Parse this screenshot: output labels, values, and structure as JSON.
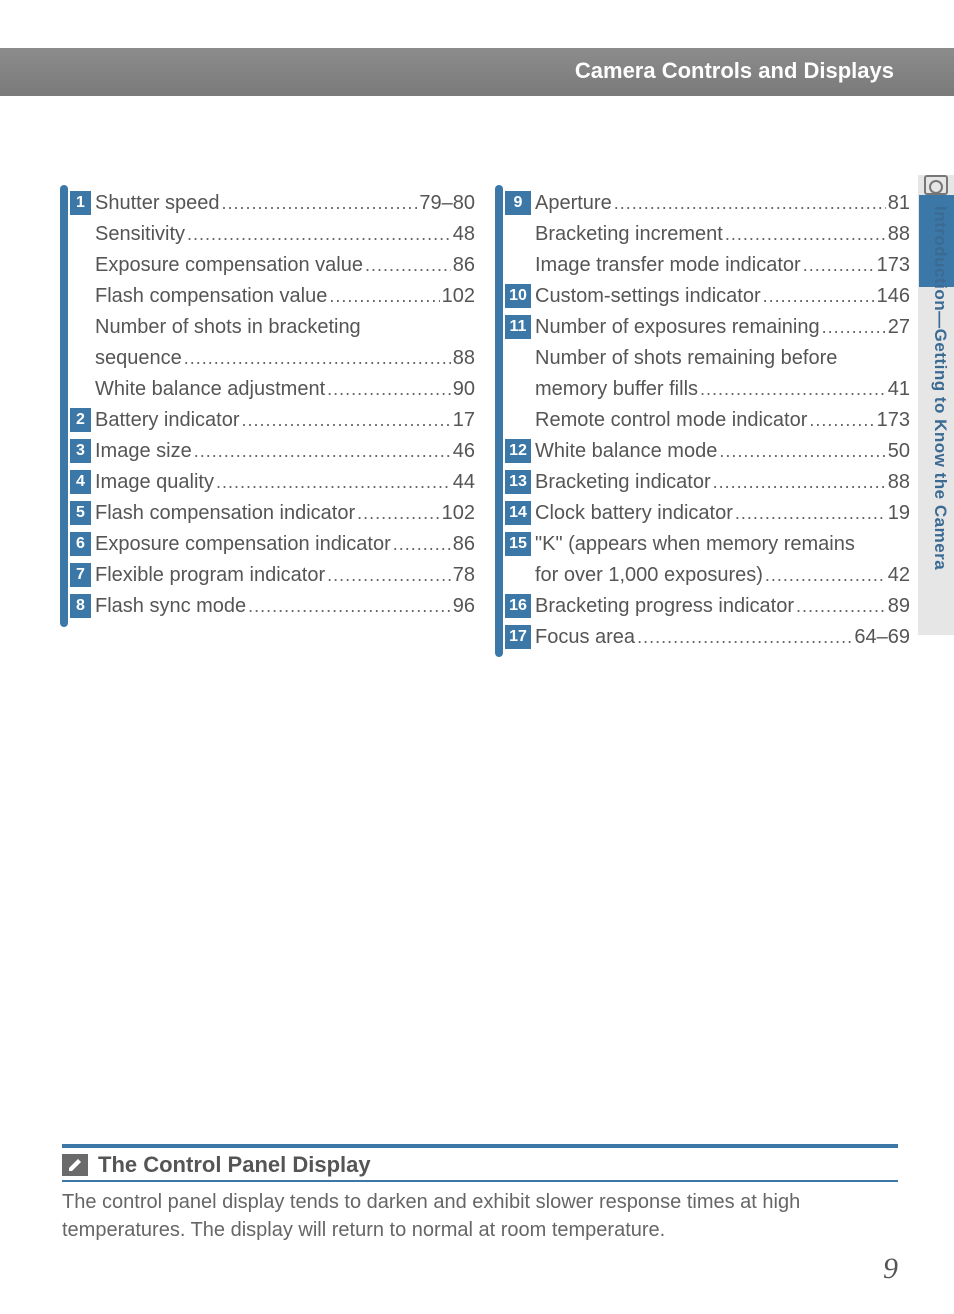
{
  "header": {
    "title": "Camera Controls and Displays"
  },
  "side": {
    "text": "Introduction—Getting to Know the Camera"
  },
  "left_col": [
    {
      "num": "1",
      "label": "Shutter speed",
      "page": "79–80"
    },
    {
      "num": "",
      "label": "Sensitivity",
      "page": "48"
    },
    {
      "num": "",
      "label": "Exposure compensation value",
      "page": "86"
    },
    {
      "num": "",
      "label": "Flash compensation value",
      "page": "102"
    },
    {
      "num": "",
      "label": "Number of shots in bracketing",
      "page": "",
      "nowrap_continue": true
    },
    {
      "num": "",
      "label": "sequence",
      "page": "88"
    },
    {
      "num": "",
      "label": "White balance adjustment",
      "page": "90"
    },
    {
      "num": "2",
      "label": "Battery indicator",
      "page": "17"
    },
    {
      "num": "3",
      "label": "Image size",
      "page": "46"
    },
    {
      "num": "4",
      "label": "Image quality",
      "page": "44"
    },
    {
      "num": "5",
      "label": "Flash compensation indicator",
      "page": "102"
    },
    {
      "num": "6",
      "label": "Exposure compensation indicator",
      "page": "86"
    },
    {
      "num": "7",
      "label": "Flexible program indicator",
      "page": "78"
    },
    {
      "num": "8",
      "label": "Flash sync mode",
      "page": "96"
    }
  ],
  "right_col": [
    {
      "num": "9",
      "label": "Aperture",
      "page": "81"
    },
    {
      "num": "",
      "label": "Bracketing increment",
      "page": "88"
    },
    {
      "num": "",
      "label": "Image transfer mode indicator",
      "page": "173"
    },
    {
      "num": "10",
      "label": "Custom-settings indicator",
      "page": "146"
    },
    {
      "num": "11",
      "label": "Number of exposures remaining",
      "page": "27"
    },
    {
      "num": "",
      "label": "Number of shots remaining before",
      "page": "",
      "nowrap_continue": true
    },
    {
      "num": "",
      "label": "memory buffer fills",
      "page": "41"
    },
    {
      "num": "",
      "label": "Remote control mode indicator",
      "page": "173"
    },
    {
      "num": "12",
      "label": "White balance mode",
      "page": "50"
    },
    {
      "num": "13",
      "label": "Bracketing indicator",
      "page": "88"
    },
    {
      "num": "14",
      "label": "Clock battery indicator",
      "page": "19"
    },
    {
      "num": "15",
      "label": "\"K\" (appears when memory remains",
      "page": "",
      "nowrap_continue": true
    },
    {
      "num": "",
      "label": "for over 1,000 exposures)",
      "page": "42"
    },
    {
      "num": "16",
      "label": "Bracketing progress indicator",
      "page": "89"
    },
    {
      "num": "17",
      "label": "Focus area",
      "page": "64–69"
    }
  ],
  "note": {
    "title": "The Control Panel Display",
    "body": "The control panel display tends to darken and exhibit slower response times at high temperatures.  The display will return to normal at room temperature."
  },
  "page_number": "9"
}
